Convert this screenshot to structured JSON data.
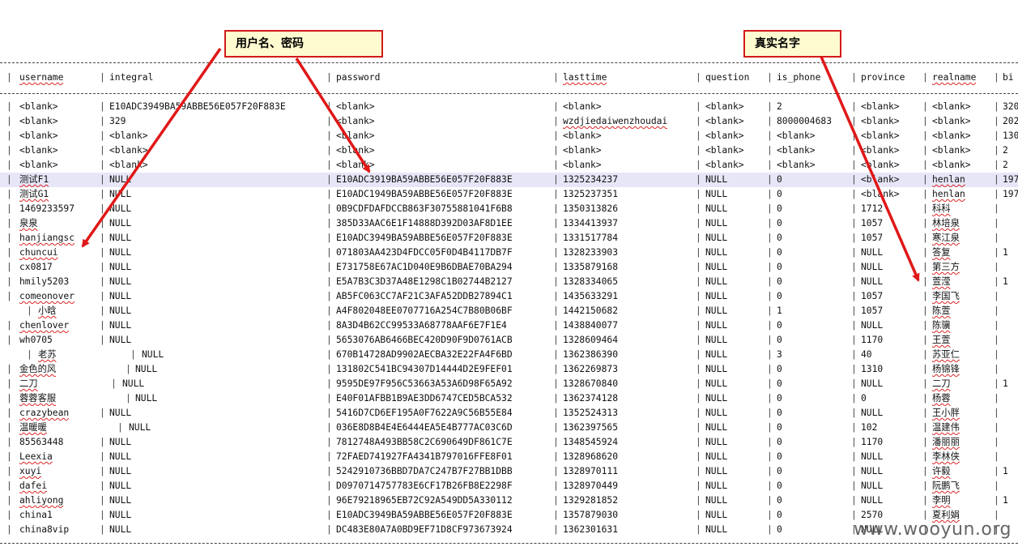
{
  "callouts": {
    "userpass": "用户名、密码",
    "realname": "真实名字"
  },
  "watermark": "www.wooyun.org",
  "colors": {
    "arrow": "#e01818",
    "callout_bg": "#fffbd0",
    "callout_border": "#d21a1a",
    "highlight_row": "#e6e6f7"
  },
  "table": {
    "headers": [
      "username",
      "integral",
      "password",
      "lasttime",
      "question",
      "is_phone",
      "province",
      "realname",
      "bi"
    ],
    "rows": [
      [
        "<blank>",
        "E10ADC3949BA59ABBE56E057F20F883E",
        "<blank>",
        "<blank>",
        "<blank>",
        "2",
        "<blank>",
        "<blank>",
        "320"
      ],
      [
        "<blank>",
        "329",
        "<blank>",
        "wzdjiedaiwenzhoudai",
        "<blank>",
        "8000004683",
        "<blank>",
        "<blank>",
        "202"
      ],
      [
        "<blank>",
        "<blank>",
        "<blank>",
        "<blank>",
        "<blank>",
        "<blank>",
        "<blank>",
        "<blank>",
        "130"
      ],
      [
        "<blank>",
        "<blank>",
        "<blank>",
        "<blank>",
        "<blank>",
        "<blank>",
        "<blank>",
        "<blank>",
        "2"
      ],
      [
        "<blank>",
        "<blank>",
        "<blank>",
        "<blank>",
        "<blank>",
        "<blank>",
        "<blank>",
        "<blank>",
        "2"
      ],
      [
        "测试F1",
        "NULL",
        "E10ADC3919BA59ABBE56E057F20F883E",
        "1325234237",
        "NULL",
        "0",
        "<blank>",
        "henlan",
        "197"
      ],
      [
        "测试G1",
        "NULL",
        "E10ADC1949BA59ABBE56E057F20F883E",
        "1325237351",
        "NULL",
        "0",
        "<blank>",
        "henlan",
        "197"
      ],
      [
        "1469233597",
        "NULL",
        "0B9CDFDAFDCCB863F30755881041F6B8",
        "1350313826",
        "NULL",
        "0",
        "1712",
        "科科",
        ""
      ],
      [
        "泉泉",
        "NULL",
        "385D33AAC6E1F14888D392D03AF8D1EE",
        "1334413937",
        "NULL",
        "0",
        "1057",
        "林培泉",
        ""
      ],
      [
        "hanjiangsc",
        "NULL",
        "E10ADC3949BA59ABBE56E057F20F883E",
        "1331517784",
        "NULL",
        "0",
        "1057",
        "寒江泉",
        ""
      ],
      [
        "chuncui",
        "NULL",
        "071803AA423D4FDCC05F0D4B4117DB7F",
        "1328233903",
        "NULL",
        "0",
        "NULL",
        "答复",
        "1"
      ],
      [
        "cx0817",
        "NULL",
        "E731758E67AC1D040E9B6DBAE70BA294",
        "1335879168",
        "NULL",
        "0",
        "NULL",
        "第三方",
        ""
      ],
      [
        "hmily5203",
        "NULL",
        "E5A7B3C3D37A48E1298C1B02744B2127",
        "1328334065",
        "NULL",
        "0",
        "NULL",
        "萱滢",
        "1"
      ],
      [
        "comeonover",
        "NULL",
        "AB5FC063CC7AF21C3AFA52DDB27894C1",
        "1435633291",
        "NULL",
        "0",
        "1057",
        "李国飞",
        ""
      ],
      [
        "小晗",
        "NULL",
        "A4F802048EE0707716A254C7B80B06BF",
        "1442150682",
        "NULL",
        "1",
        "1057",
        "陈萱",
        ""
      ],
      [
        "chenlover",
        "NULL",
        "8A3D4B62CC99533A68778AAF6E7F1E4",
        "1438840077",
        "NULL",
        "0",
        "NULL",
        "陈骥",
        ""
      ],
      [
        "wh0705",
        "NULL",
        "5653076AB6466BEC420D90F9D0761ACB",
        "1328609464",
        "NULL",
        "0",
        "1170",
        "王萱",
        ""
      ],
      [
        "老苏",
        "NULL",
        "670B14728AD9902AECBA32E22FA4F6BD",
        "1362386390",
        "NULL",
        "3",
        "40",
        "苏亚仁",
        ""
      ],
      [
        "金色的风",
        "NULL",
        "131802C541BC94307D14444D2E9FEF01",
        "1362269873",
        "NULL",
        "0",
        "1310",
        "杨锦锋",
        ""
      ],
      [
        "二刀",
        "NULL",
        "9595DE97F956C53663A53A6D98F65A92",
        "1328670840",
        "NULL",
        "0",
        "NULL",
        "二刀",
        "1"
      ],
      [
        "蓉蓉客服",
        "NULL",
        "E40F01AFBB1B9AE3DD6747CED5BCA532",
        "1362374128",
        "NULL",
        "0",
        "0",
        "杨蓉",
        ""
      ],
      [
        "crazybean",
        "NULL",
        "5416D7CD6EF195A0F7622A9C56B55E84",
        "1352524313",
        "NULL",
        "0",
        "NULL",
        "王小胖",
        ""
      ],
      [
        "温暖暖",
        "NULL",
        "036E8D8B4E4E6444EA5E4B777AC03C6D",
        "1362397565",
        "NULL",
        "0",
        "102",
        "温建伟",
        ""
      ],
      [
        "85563448",
        "NULL",
        "7812748A493BB58C2C690649DF861C7E",
        "1348545924",
        "NULL",
        "0",
        "1170",
        "潘丽丽",
        ""
      ],
      [
        "Leexia",
        "NULL",
        "72FAED741927FA4341B797016FFE8F01",
        "1328968620",
        "NULL",
        "0",
        "NULL",
        "李林侠",
        ""
      ],
      [
        "xuyi",
        "NULL",
        "5242910736BBD7DA7C247B7F27BB1DBB",
        "1328970111",
        "NULL",
        "0",
        "NULL",
        "许毅",
        "1"
      ],
      [
        "dafei",
        "NULL",
        "D0970714757783E6CF17B26FB8E2298F",
        "1328970449",
        "NULL",
        "0",
        "NULL",
        "阮鹏飞",
        ""
      ],
      [
        "ahliyong",
        "NULL",
        "96E79218965EB72C92A549DD5A330112",
        "1329281852",
        "NULL",
        "0",
        "NULL",
        "李明",
        "1"
      ],
      [
        "china1",
        "NULL",
        "E10ADC3949BA59ABBE56E057F20F883E",
        "1357879030",
        "NULL",
        "0",
        "2570",
        "夏利娟",
        ""
      ],
      [
        "china8vip",
        "NULL",
        "DC483E80A7A0BD9EF71D8CF973673924",
        "1362301631",
        "NULL",
        "0",
        "NULL",
        "",
        ""
      ]
    ]
  }
}
